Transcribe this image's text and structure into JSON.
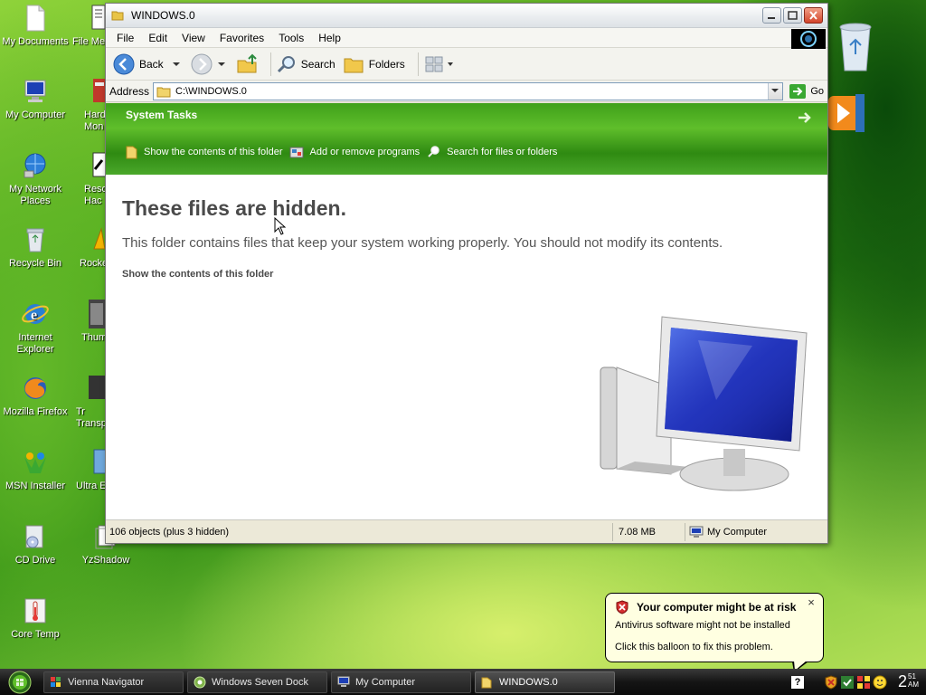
{
  "desktop": {
    "icons_left": [
      {
        "label": "My Documents",
        "icon": "documents-icon"
      },
      {
        "label": "My Computer",
        "icon": "computer-icon"
      },
      {
        "label": "My Network Places",
        "icon": "network-icon"
      },
      {
        "label": "Recycle Bin",
        "icon": "recycle-bin-icon"
      },
      {
        "label": "Internet Explorer",
        "icon": "ie-icon"
      },
      {
        "label": "Mozilla Firefox",
        "icon": "firefox-icon"
      },
      {
        "label": "MSN Installer",
        "icon": "msn-icon"
      },
      {
        "label": "CD Drive",
        "icon": "cd-drive-icon"
      },
      {
        "label": "Core Temp",
        "icon": "thermometer-icon"
      }
    ],
    "icons_second_column": [
      {
        "label": "File Mer",
        "icon": "file-icon"
      },
      {
        "label": "Hard Mon",
        "icon": "hardware-icon"
      },
      {
        "label": "Reso Hac",
        "icon": "resource-hacker-icon"
      },
      {
        "label": "Rocke",
        "icon": "rocket-icon"
      },
      {
        "label": "Thum",
        "icon": "thumbnail-icon"
      },
      {
        "label": "Tr Transp",
        "icon": "transparency-icon"
      },
      {
        "label": "Ultra E",
        "icon": "ultra-icon"
      },
      {
        "label": "YzShadow",
        "icon": "shadow-icon"
      }
    ]
  },
  "window": {
    "title": "WINDOWS.0",
    "menu": [
      "File",
      "Edit",
      "View",
      "Favorites",
      "Tools",
      "Help"
    ],
    "toolbar": {
      "back": "Back",
      "search": "Search",
      "folders": "Folders"
    },
    "address": {
      "label": "Address",
      "value": "C:\\WINDOWS.0",
      "go": "Go"
    },
    "system_tasks": {
      "header": "System Tasks",
      "links": [
        "Show the contents of this folder",
        "Add or remove programs",
        "Search for files or folders"
      ]
    },
    "hidden_title": "These files are hidden.",
    "hidden_desc": "This folder contains files that keep your system working properly. You should not modify its contents.",
    "show_link": "Show the contents of this folder",
    "status": {
      "objects": "106 objects (plus 3 hidden)",
      "size": "7.08 MB",
      "location": "My Computer"
    }
  },
  "balloon": {
    "title": "Your computer might be at risk",
    "line1": "Antivirus software might not be installed",
    "line2": "Click this balloon to fix this problem.",
    "close": "×"
  },
  "taskbar": {
    "tasks": [
      {
        "label": "Vienna Navigator",
        "active": false
      },
      {
        "label": "Windows Seven Dock",
        "active": false
      },
      {
        "label": "My Computer",
        "active": false
      },
      {
        "label": "WINDOWS.0",
        "active": true
      }
    ],
    "clock_hour": "2",
    "clock_min": "51",
    "clock_ampm": "AM",
    "help_glyph": "?"
  },
  "colors": {
    "tasks_green": "#3fa01a",
    "balloon_bg": "#ffffe1",
    "taskbar": "#151515"
  }
}
